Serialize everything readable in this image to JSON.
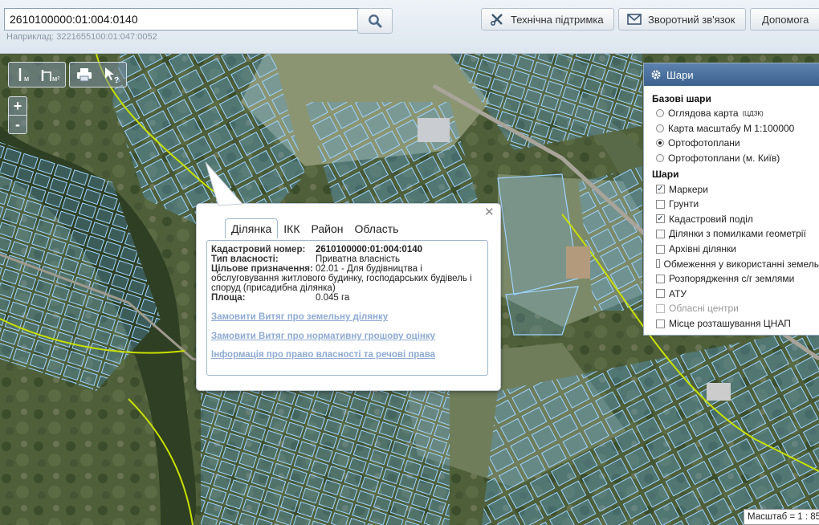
{
  "search": {
    "value": "2610100000:01:004:0140",
    "hint": "Наприклад: 3221655100:01:047:0052"
  },
  "header": {
    "support_label": "Технічна підтримка",
    "feedback_label": "Зворотний зв'язок",
    "help_label": "Допомога"
  },
  "tools": {
    "measure_line_sub": "м",
    "measure_area_sub": "м²"
  },
  "zoom": {
    "in": "+",
    "out": "-"
  },
  "layers": {
    "title": "Шари",
    "base_title": "Базові шари",
    "base": [
      {
        "label": "Оглядова карта",
        "sup": "(ЦДЗК)",
        "selected": false
      },
      {
        "label": "Карта масштабу М 1:100000",
        "selected": false
      },
      {
        "label": "Ортофотоплани",
        "selected": true
      },
      {
        "label": "Ортофотоплани (м. Київ)",
        "selected": false
      }
    ],
    "overlay_title": "Шари",
    "overlays": [
      {
        "label": "Маркери",
        "checked": true,
        "disabled": false
      },
      {
        "label": "Грунти",
        "checked": false,
        "disabled": false
      },
      {
        "label": "Кадастровий поділ",
        "checked": true,
        "disabled": false
      },
      {
        "label": "Ділянки з помилками геометрії",
        "checked": false,
        "disabled": false
      },
      {
        "label": "Архівні ділянки",
        "checked": false,
        "disabled": false
      },
      {
        "label": "Обмеження у використанні земель",
        "checked": false,
        "disabled": false
      },
      {
        "label": "Розпорядження с/г землями",
        "checked": false,
        "disabled": false
      },
      {
        "label": "АТУ",
        "checked": false,
        "disabled": false
      },
      {
        "label": "Обласні центри",
        "checked": false,
        "disabled": true
      },
      {
        "label": "Місце розташування ЦНАП",
        "checked": false,
        "disabled": false
      }
    ]
  },
  "popup": {
    "close": "✕",
    "tabs": [
      "Ділянка",
      "ІКК",
      "Район",
      "Область"
    ],
    "active_tab": 0,
    "fields": [
      {
        "label": "Кадастровий номер:",
        "value": "2610100000:01:004:0140",
        "bold": true
      },
      {
        "label": "Тип власності:",
        "value": "Приватна власність",
        "bold": false
      },
      {
        "label": "Цільове призначення:",
        "value": "02.01 - Для будівництва і обслуговування житлового будинку, господарських будівель і споруд (присадибна ділянка)",
        "bold": false
      },
      {
        "label": "Площа:",
        "value": "0.045 га",
        "bold": false
      }
    ],
    "links": [
      "Замовити Витяг про земельну ділянку",
      "Замовити Витяг про нормативну грошову оцінку",
      "Інформація про право власності та речові права"
    ]
  },
  "scale": {
    "text": "Масштаб = 1 : 85"
  },
  "colors": {
    "parcel_stroke": "#9cd4ff",
    "parcel_fill": "#5aa0d8",
    "boundary": "#c8e000",
    "panel_header": "#4a6f9c",
    "link": "#8eaad3"
  }
}
